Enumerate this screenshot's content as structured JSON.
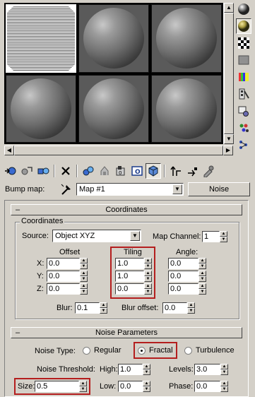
{
  "sample_slots": [
    {
      "name": "slot-1",
      "active": true
    },
    {
      "name": "slot-2",
      "active": false
    },
    {
      "name": "slot-3",
      "active": false
    },
    {
      "name": "slot-4",
      "active": false
    },
    {
      "name": "slot-5",
      "active": false
    },
    {
      "name": "slot-6",
      "active": false
    }
  ],
  "side_tools": [
    "sample-type-sphere-icon",
    "backlight-icon",
    "background-checker-icon",
    "sample-uv-tiling-icon",
    "video-color-check-icon",
    "make-preview-icon",
    "options-icon",
    "select-by-material-icon",
    "material-map-navigator-icon"
  ],
  "toolbar_icons": [
    "get-material-icon",
    "put-to-scene-icon",
    "assign-to-selection-icon",
    "reset-map-icon",
    "make-unique-icon",
    "put-to-library-icon",
    "material-id-channel-icon",
    "show-map-in-viewport-icon",
    "show-end-result-icon",
    "go-to-parent-icon",
    "go-forward-to-sibling-icon",
    "pick-material-from-object-icon"
  ],
  "name_row": {
    "label": "Bump map:",
    "map_name": "Map #1",
    "type_button": "Noise"
  },
  "coordinates": {
    "rollout_title": "Coordinates",
    "group_title": "Coordinates",
    "source_label": "Source:",
    "source_value": "Object XYZ",
    "map_channel_label": "Map Channel:",
    "map_channel_value": "1",
    "offset_label": "Offset",
    "tiling_label": "Tiling",
    "angle_label": "Angle:",
    "axes": [
      "X:",
      "Y:",
      "Z:"
    ],
    "offset": [
      "0.0",
      "0.0",
      "0.0"
    ],
    "tiling": [
      "1.0",
      "1.0",
      "0.0"
    ],
    "angle": [
      "0.0",
      "0.0",
      "0.0"
    ],
    "blur_label": "Blur:",
    "blur_value": "0.1",
    "blur_offset_label": "Blur offset:",
    "blur_offset_value": "0.0"
  },
  "noise": {
    "rollout_title": "Noise Parameters",
    "noise_type_label": "Noise Type:",
    "types": [
      "Regular",
      "Fractal",
      "Turbulence"
    ],
    "selected_type": "Fractal",
    "threshold_label": "Noise Threshold:",
    "high_label": "High:",
    "high_value": "1.0",
    "levels_label": "Levels:",
    "levels_value": "3.0",
    "size_label": "Size:",
    "size_value": "0.5",
    "low_label": "Low:",
    "low_value": "0.0",
    "phase_label": "Phase:",
    "phase_value": "0.0"
  },
  "colors": {
    "panel": "#d4d0c8",
    "highlight": "#b41e1e"
  }
}
